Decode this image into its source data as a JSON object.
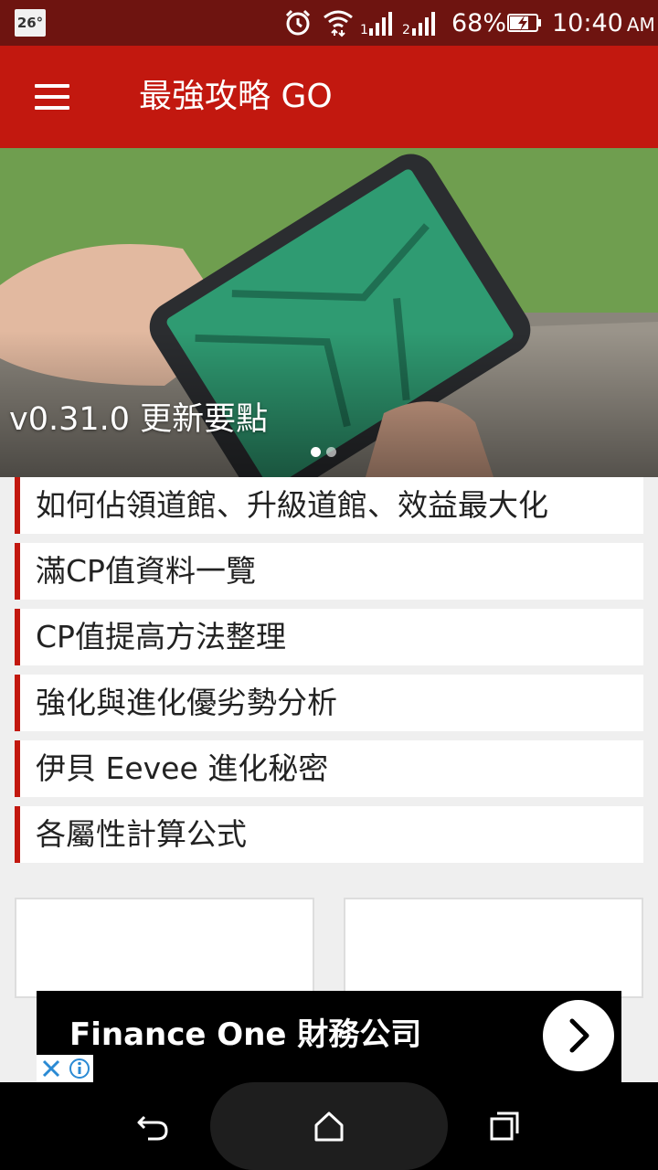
{
  "status_bar": {
    "temperature": "26°",
    "battery_percent": "68%",
    "time": "10:40",
    "time_suffix": "AM",
    "icons": [
      "alarm-icon",
      "wifi-icon",
      "signal-1-icon",
      "signal-2-icon",
      "battery-charging-icon"
    ]
  },
  "app_bar": {
    "title": "最強攻略 GO",
    "menu_icon": "hamburger-menu-icon",
    "color": "#c2180f"
  },
  "carousel": {
    "slide_title": "v0.31.0 更新要點",
    "slide_count": 2,
    "active_index": 0
  },
  "articles": [
    {
      "title": "如何佔領道館、升級道館、效益最大化"
    },
    {
      "title": "滿CP值資料一覽"
    },
    {
      "title": "CP值提高方法整理"
    },
    {
      "title": "強化與進化優劣勢分析"
    },
    {
      "title": "伊貝 Eevee 進化秘密"
    },
    {
      "title": "各屬性計算公式"
    }
  ],
  "ad": {
    "text": "Finance One 財務公司",
    "arrow_icon": "chevron-right-icon",
    "close_icon": "close-x-icon",
    "info_icon": "info-icon"
  },
  "nav_bar": {
    "icons": [
      "back-icon",
      "home-icon",
      "recents-icon"
    ]
  },
  "colors": {
    "accent": "#c2180f",
    "status_bar": "#6e1410",
    "background": "#efefef"
  }
}
